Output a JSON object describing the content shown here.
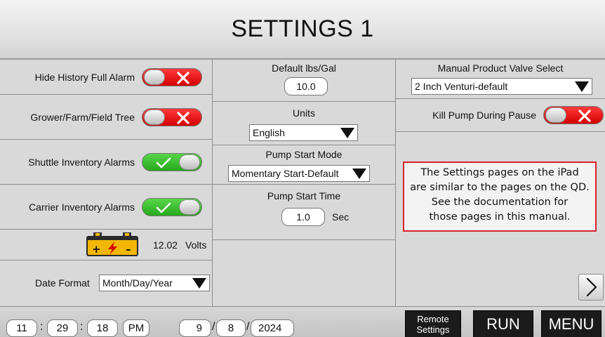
{
  "header": {
    "title": "SETTINGS 1"
  },
  "left": {
    "hide_history_full_alarm": {
      "label": "Hide History Full Alarm",
      "state": "off"
    },
    "grower_farm_field_tree": {
      "label": "Grower/Farm/Field Tree",
      "state": "off"
    },
    "shuttle_inventory_alarms": {
      "label": "Shuttle Inventory Alarms",
      "state": "on"
    },
    "carrier_inventory_alarms": {
      "label": "Carrier Inventory Alarms",
      "state": "on"
    },
    "battery": {
      "value": "12.02",
      "unit": "Volts"
    },
    "date_format": {
      "label": "Date Format",
      "value": "Month/Day/Year"
    }
  },
  "middle": {
    "default_lbs_gal": {
      "label": "Default lbs/Gal",
      "value": "10.0"
    },
    "units": {
      "label": "Units",
      "value": "English"
    },
    "pump_start_mode": {
      "label": "Pump Start Mode",
      "value": "Momentary Start-Default"
    },
    "pump_start_time": {
      "label": "Pump Start Time",
      "value": "1.0",
      "unit": "Sec"
    }
  },
  "right": {
    "manual_product_valve_select": {
      "label": "Manual Product Valve Select",
      "value": "2 Inch Venturi-default"
    },
    "kill_pump_during_pause": {
      "label": "Kill Pump During Pause",
      "state": "off"
    },
    "note_lines": [
      "The Settings pages on the iPad",
      "are similar to the pages on the QD.",
      "See the documentation for",
      "those pages in this manual."
    ],
    "next_icon": "chevron-right-icon"
  },
  "footer": {
    "time": {
      "hour": "11",
      "minute": "29",
      "second": "18",
      "ampm": "PM"
    },
    "date": {
      "month": "9",
      "day": "8",
      "year": "2024"
    },
    "remote_settings_lines": [
      "Remote",
      "Settings"
    ],
    "run_label": "RUN",
    "menu_label": "MENU"
  },
  "colors": {
    "toggle_on": "#27a81c",
    "toggle_off": "#d40000",
    "note_border": "#d8222a",
    "battery": "#f2b705"
  }
}
